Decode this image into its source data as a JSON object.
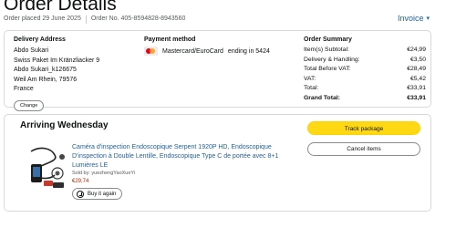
{
  "header": {
    "title": "Order Details",
    "order_placed": "Order placed 29 June 2025",
    "order_number": "Order No. 405-8594828-8943560",
    "invoice_label": "Invoice"
  },
  "delivery": {
    "title": "Delivery Address",
    "lines": [
      "Abdo Sukari",
      "Swiss Paket Im Kränzliacker 9",
      "Abdo Sukari_k126675",
      "Weil Am Rhein, 79576",
      "France"
    ],
    "change_label": "Change"
  },
  "payment": {
    "title": "Payment method",
    "method": "Mastercard/EuroCard",
    "ending": "ending in 5424",
    "card_icon": "mastercard-icon"
  },
  "summary": {
    "title": "Order Summary",
    "rows": [
      {
        "label": "Item(s) Subtotal:",
        "value": "€24,99"
      },
      {
        "label": "Delivery & Handling:",
        "value": "€3,50"
      },
      {
        "label": "Total Before VAT:",
        "value": "€28,49"
      },
      {
        "label": "VAT:",
        "value": "€5,42"
      },
      {
        "label": "Total:",
        "value": "€33,91"
      }
    ],
    "grand_label": "Grand Total:",
    "grand_value": "€33,91"
  },
  "shipment": {
    "status": "Arriving Wednesday",
    "track_label": "Track package",
    "cancel_label": "Cancel items",
    "product_title": "Caméra d'inspection Endoscopique Serpent 1920P HD, Endoscopique D'inspection à Double Lentille, Endoscopique Type C de portée avec 8+1 Lumières LE",
    "seller": "Sold by: yuezhengYaoXueYi",
    "price": "€29,74",
    "buy_again_label": "Buy it again"
  },
  "colors": {
    "link": "#2162a1",
    "track_button": "#ffd814",
    "price": "#b12704"
  }
}
